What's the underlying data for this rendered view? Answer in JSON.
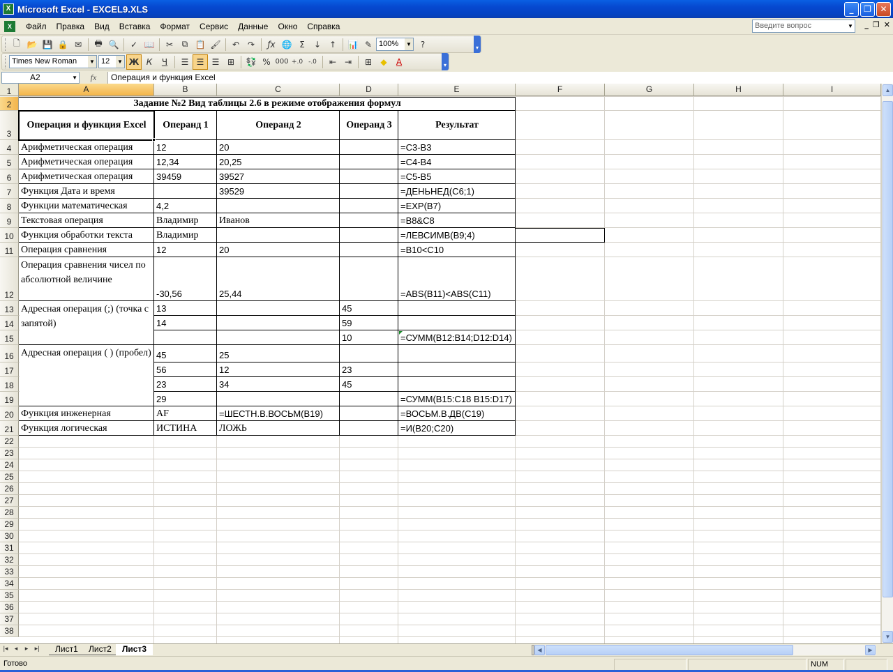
{
  "window": {
    "title": "Microsoft Excel - EXCEL9.XLS",
    "app_icon": "X"
  },
  "menu": {
    "items": [
      "Файл",
      "Правка",
      "Вид",
      "Вставка",
      "Формат",
      "Сервис",
      "Данные",
      "Окно",
      "Справка"
    ],
    "ask_placeholder": "Введите вопрос"
  },
  "toolbar": {
    "zoom": "100%",
    "font_name": "Times New Roman",
    "font_size": "12"
  },
  "formula_bar": {
    "name_box": "A2",
    "fx": "fx",
    "formula": "Операция и функция Excel"
  },
  "columns": [
    "A",
    "B",
    "C",
    "D",
    "E",
    "F",
    "G",
    "H",
    "I"
  ],
  "rows": [
    "1",
    "2",
    "3",
    "4",
    "5",
    "6",
    "7",
    "8",
    "9",
    "10",
    "11",
    "12",
    "13",
    "14",
    "15",
    "16",
    "17",
    "18",
    "19",
    "20",
    "21",
    "22",
    "23",
    "24",
    "25",
    "26",
    "27",
    "28",
    "29",
    "30",
    "31",
    "32",
    "33",
    "34",
    "35",
    "36",
    "37",
    "38"
  ],
  "sheet": {
    "title": "Задание №2 Вид таблицы 2.6 в режиме отображения формул",
    "headers": {
      "a": "Операция и функция Excel",
      "b": "Операнд 1",
      "c": "Операнд 2",
      "d": "Операнд 3",
      "e": "Результат"
    },
    "r3": {
      "a": "Арифметическая операция",
      "b": "12",
      "c": "20",
      "e": "=C3-B3"
    },
    "r4": {
      "a": "Арифметическая операция",
      "b": "12,34",
      "c": "20,25",
      "e": "=C4-B4"
    },
    "r5": {
      "a": "Арифметическая операция",
      "b": "39459",
      "c": "39527",
      "e": "=C5-B5"
    },
    "r6": {
      "a": "Функция Дата и время",
      "c": "39529",
      "e": "=ДЕНЬНЕД(C6;1)"
    },
    "r7": {
      "a": "Функции математическая",
      "b": "4,2",
      "e": "=EXP(B7)"
    },
    "r8": {
      "a": "Текстовая операция",
      "b": "Владимир",
      "c": "Иванов",
      "e": "=B8&C8"
    },
    "r9": {
      "a": "Функция обработки текста",
      "b": "Владимир",
      "e": "=ЛЕВСИМВ(B9;4)"
    },
    "r10": {
      "a": "Операция сравнения",
      "b": "12",
      "c": "20",
      "e": "=B10<C10"
    },
    "r11": {
      "a": "Операция сравнения чисел по абсолютной величине",
      "b": "-30,56",
      "c": "25,44",
      "e": "=ABS(B11)<ABS(C11)"
    },
    "r12": {
      "a": "Адресная операция (;) (точка с запятой)",
      "b": "13",
      "d": "45"
    },
    "r13": {
      "b": "14",
      "d": "59"
    },
    "r14": {
      "d": "10",
      "e": "=СУММ(B12:B14;D12:D14)"
    },
    "r15": {
      "a": "Адресная операция ( ) (пробел)",
      "b": "45",
      "c": "25"
    },
    "r16": {
      "b": "56",
      "c": "12",
      "d": "23"
    },
    "r17": {
      "b": "23",
      "c": "34",
      "d": "45"
    },
    "r18": {
      "b": "29",
      "e": "=СУММ(B15:C18 B15:D17)"
    },
    "r19": {
      "a": "Функция инженерная",
      "b": "AF",
      "c": "=ШЕСТН.В.ВОСЬМ(B19)",
      "e": "=ВОСЬМ.В.ДВ(C19)"
    },
    "r20": {
      "a": "Функция логическая",
      "b": "ИСТИНА",
      "c": "ЛОЖЬ",
      "e": "=И(B20;C20)"
    }
  },
  "tabs": [
    "Лист1",
    "Лист2",
    "Лист3"
  ],
  "status": {
    "text": "Готово",
    "num": "NUM"
  }
}
